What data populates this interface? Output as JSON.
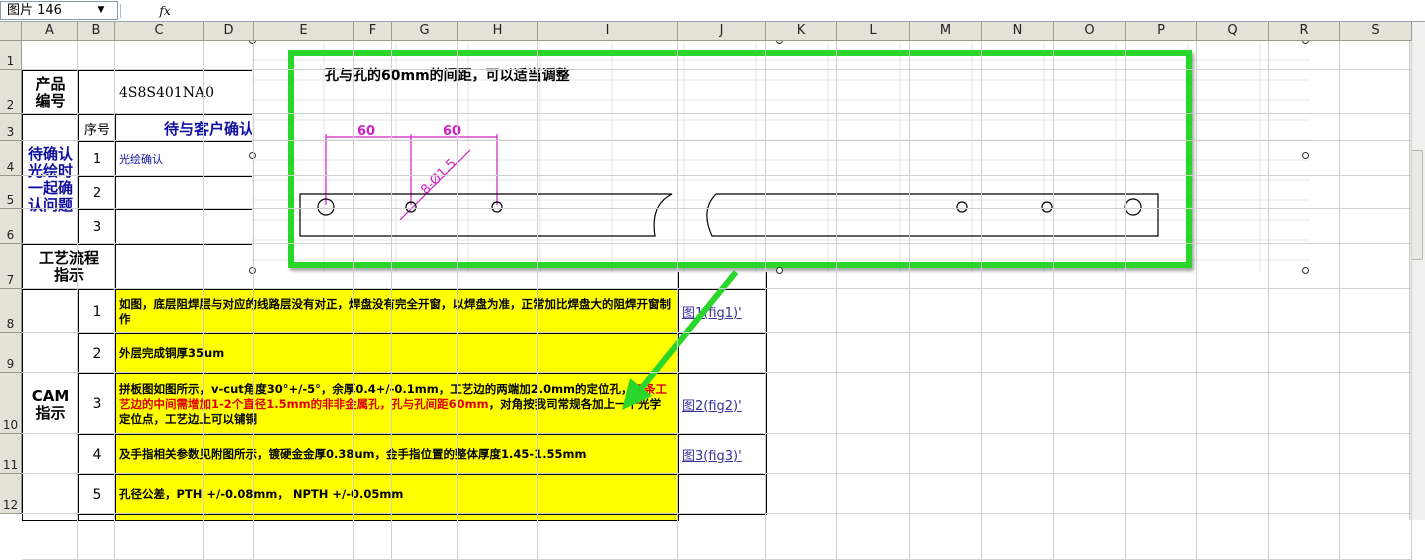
{
  "formula_bar": {
    "name_box": "图片 146",
    "name_box_arrow": "▼",
    "fx_label": "fx"
  },
  "columns": [
    "A",
    "B",
    "C",
    "D",
    "E",
    "F",
    "G",
    "H",
    "I",
    "J",
    "K",
    "L",
    "M",
    "N",
    "O",
    "P",
    "Q",
    "R",
    "S"
  ],
  "rows": [
    "1",
    "2",
    "3",
    "4",
    "5",
    "6",
    "7",
    "8",
    "9",
    "10",
    "11",
    "12"
  ],
  "sheet": {
    "product_code_label": "产品\n编号",
    "product_code_value": "4S8S401NA0",
    "pending_label": "待确认\n光绘时\n一起确\n认问题",
    "seq_header": "序号",
    "pending_header": "待与客户确认",
    "pending_items": [
      {
        "no": "1",
        "text": "光绘确认"
      },
      {
        "no": "2",
        "text": ""
      },
      {
        "no": "3",
        "text": ""
      }
    ],
    "process_label": "工艺流程\n指示",
    "cam_label": "CAM\n指示",
    "cam_items": [
      {
        "no": "1",
        "text": "如图，底层阻焊层与对应的线路层没有对正，焊盘没有完全开窗，以焊盘为准，正常加比焊盘大的阻焊开窗制作",
        "link": "图1(fig1)'"
      },
      {
        "no": "2",
        "text": "外层完成铜厚35um",
        "link": ""
      },
      {
        "no": "3",
        "text_pre": "拼板图如图所示，v-cut角度30°+/-5°，余厚0.4+/-0.1mm，工艺边的两端加2.0mm的定位孔，",
        "text_red": "每条工艺边的中间需增加1-2个直径1.5mm的非非金属孔，孔与孔间距60mm",
        "text_post": "，对角按我司常规各加上一个光学定位点，工艺边上可以铺铜",
        "link": "图2(fig2)'"
      },
      {
        "no": "4",
        "text": "及手指相关参数见附图所示，镀硬金金厚0.38um，金手指位置的整体厚度1.45-1.55mm",
        "link": "图3(fig3)'"
      },
      {
        "no": "5",
        "text": "孔径公差，PTH +/-0.08mm， NPTH +/-0.05mm",
        "link": ""
      }
    ]
  },
  "drawing": {
    "caption": "孔与孔的60mm的间距，可以适当调整",
    "dim_left": "60",
    "dim_right": "60",
    "hole_label": "8-Ø1.5"
  },
  "colors": {
    "highlight_yellow": "#ffff00",
    "frame_green": "#29d629",
    "dimension_magenta": "#d020c8",
    "label_blue": "#1010a0",
    "note_red": "#e00000"
  }
}
